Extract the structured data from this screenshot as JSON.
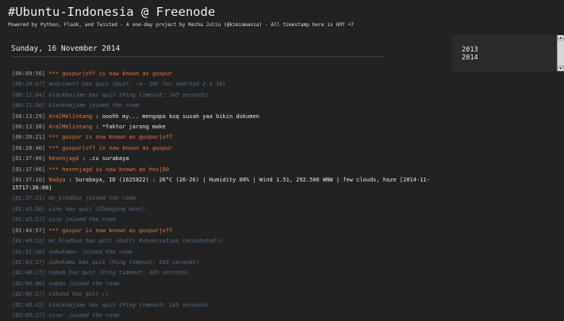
{
  "header": {
    "title": "#Ubuntu-Indonesia @ Freenode",
    "tagline": "Powered by Python, Flask, and Twisted - A one-day project by Rezha Julio (@kimiamania) - All timestamp here is GMT +7"
  },
  "log": {
    "date": "Sunday, 16 November 2014",
    "lines": [
      {
        "type": "nick-change",
        "ts": "[00:09:56]",
        "msg": "*** guspur|off is now known as guspur"
      },
      {
        "type": "event",
        "ts": "[00:10:57]",
        "msg": "andriant7 has quit (Quit: -a- IRC for Android 2.1.18)"
      },
      {
        "type": "event",
        "ts": "[00:11:04]",
        "msg": "blackhajime has quit (Ping timeout: 245 seconds)"
      },
      {
        "type": "event",
        "ts": "[00:11:30]",
        "msg": "blackhajime joined the room"
      },
      {
        "type": "message",
        "ts": "[00:13:29]",
        "nick": "AralMelintang",
        "sep": " : ",
        "text": "ooohh my... mengapa koq susah yaa bikin dokumen"
      },
      {
        "type": "message",
        "ts": "[00:13:38]",
        "nick": "AralMelintang",
        "sep": " : ",
        "text": "*faktor jarang make"
      },
      {
        "type": "nick-change",
        "ts": "[00:20:21]",
        "msg": "*** guspur is now known as guspur|off"
      },
      {
        "type": "nick-change",
        "ts": "[00:28:40]",
        "msg": "*** guspur|off is now known as guspur"
      },
      {
        "type": "message",
        "ts": "[01:37:00]",
        "nick": "hexenjagd",
        "sep": " : ",
        "text": ".cu surabaya"
      },
      {
        "type": "nick-change",
        "ts": "[01:37:06]",
        "msg": "*** hexenjagd is now known as hex|00"
      },
      {
        "type": "message",
        "ts": "[01:37:10]",
        "nick": "Nadya",
        "sep": " : ",
        "text": "Surabaya, ID (1625822) : 26°C (26-26) | Humidity 88% | Wind 1.51, 292.506 WNW | few clouds, haze [2014-11-15T17:30:00]",
        "tall": true
      },
      {
        "type": "event",
        "ts": "[01:37:21]",
        "msg": "mc_bledhoz joined the room"
      },
      {
        "type": "event",
        "ts": "[01:43:56]",
        "msg": "sinx has quit (Changing host)"
      },
      {
        "type": "event",
        "ts": "[01:43:57]",
        "msg": "sinx joined the room"
      },
      {
        "type": "nick-change",
        "ts": "[01:44:57]",
        "msg": "*** guspur is now known as guspur|off"
      },
      {
        "type": "event",
        "ts": "[01:49:52]",
        "msg": "mc_bledhoz has quit (Quit: Konversation terminated!)"
      },
      {
        "type": "event",
        "ts": "[01:51:20]",
        "msg": "sukakamu- joined the room"
      },
      {
        "type": "event",
        "ts": "[01:54:37]",
        "msg": "sukakamu has quit (Ping timeout: 245 seconds)"
      },
      {
        "type": "event",
        "ts": "[02:00:17]",
        "msg": "soban has quit (Ping timeout: 265 seconds)"
      },
      {
        "type": "event",
        "ts": "[02:04:06]",
        "msg": "soban joined the room"
      },
      {
        "type": "event",
        "ts": "[02:06:57]",
        "msg": "sibond has quit ()"
      },
      {
        "type": "event",
        "ts": "[02:40:42]",
        "msg": "blackhajime has quit (Ping timeout: 245 seconds)"
      },
      {
        "type": "event",
        "ts": "[03:03:37]",
        "msg": "sinx- joined the room"
      }
    ]
  },
  "sidebar": {
    "years": [
      "2013",
      "2014"
    ]
  },
  "icons": {
    "scroll_up": "chevron-up-icon",
    "scroll_down": "chevron-down-icon"
  },
  "colors": {
    "background": "#222222",
    "nick": "#e57844",
    "event": "#4f6b86",
    "timestamp": "#a5a5a5"
  }
}
